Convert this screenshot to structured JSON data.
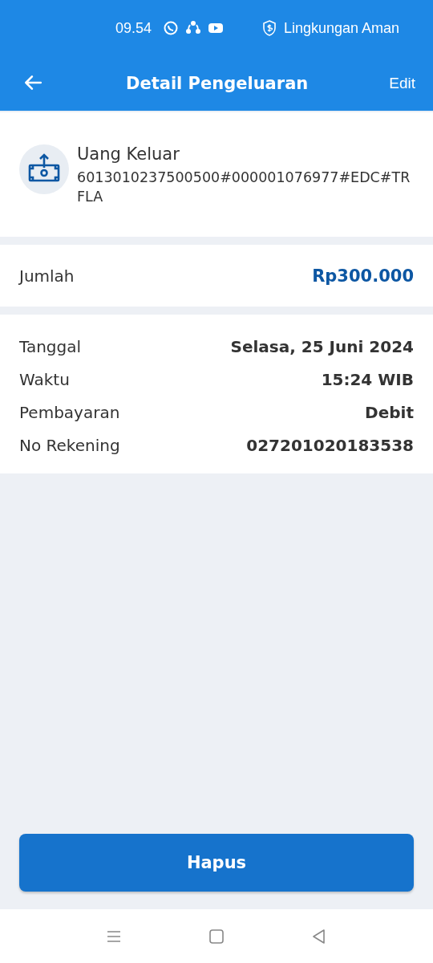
{
  "status_bar": {
    "time": "09.54",
    "security": "Lingkungan Aman"
  },
  "app_bar": {
    "title": "Detail Pengeluaran",
    "action": "Edit"
  },
  "transaction": {
    "category": "Uang Keluar",
    "description": "6013010237500500#000001076977#EDC#TRFLA"
  },
  "amount": {
    "label": "Jumlah",
    "value": "Rp300.000"
  },
  "details": [
    {
      "label": "Tanggal",
      "value": "Selasa, 25 Juni 2024"
    },
    {
      "label": "Waktu",
      "value": "15:24 WIB"
    },
    {
      "label": "Pembayaran",
      "value": "Debit"
    },
    {
      "label": "No Rekening",
      "value": "027201020183538"
    }
  ],
  "delete_button": "Hapus"
}
